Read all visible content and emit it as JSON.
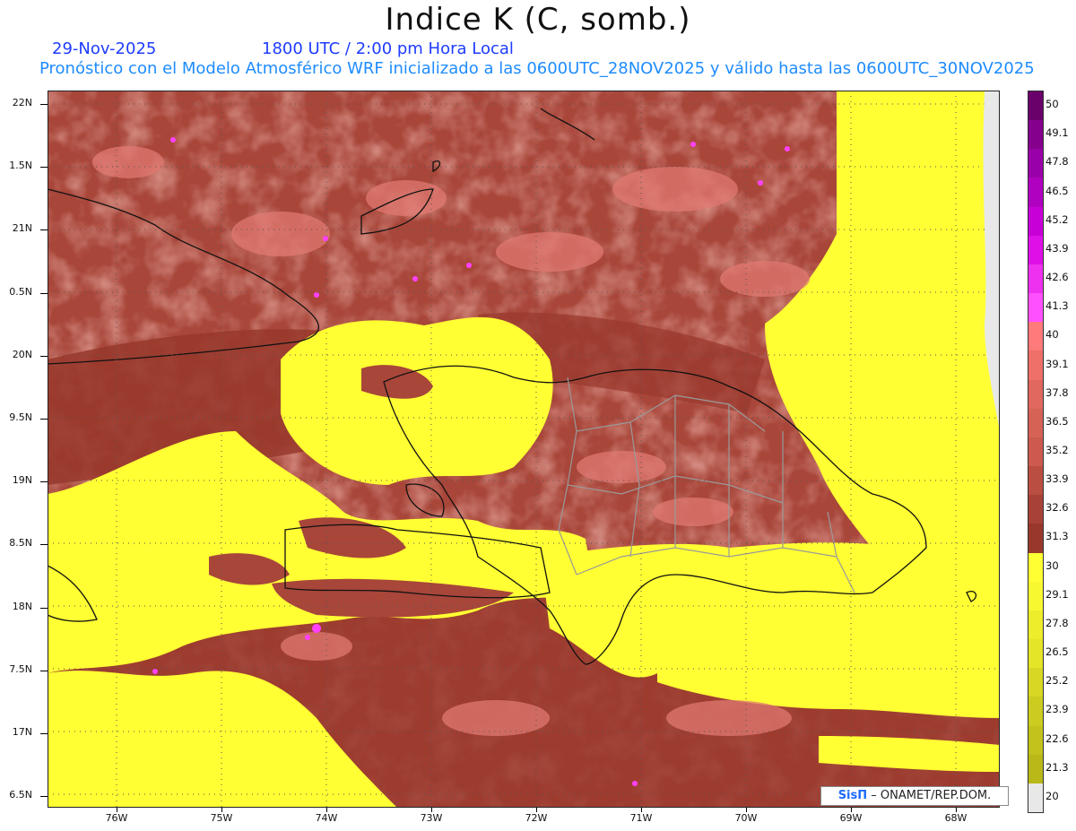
{
  "header": {
    "title": "Indice K (C, somb.)",
    "date": "29-Nov-2025",
    "time": "1800 UTC / 2:00 pm Hora Local",
    "model_line": "Pronóstico con el Modelo Atmosférico WRF inicializado a las 0600UTC_28NOV2025 y válido hasta las  0600UTC_30NOV2025"
  },
  "axes": {
    "lat_labels": [
      "22N",
      "1.5N",
      "21N",
      "0.5N",
      "20N",
      "9.5N",
      "19N",
      "8.5N",
      "18N",
      "7.5N",
      "17N",
      "6.5N"
    ],
    "lon_labels": [
      "76W",
      "75W",
      "74W",
      "73W",
      "72W",
      "71W",
      "70W",
      "69W",
      "68W"
    ]
  },
  "colorbar": {
    "labels": [
      "50",
      "49.1",
      "47.8",
      "46.5",
      "45.2",
      "43.9",
      "42.6",
      "41.3",
      "40",
      "39.1",
      "37.8",
      "36.5",
      "35.2",
      "33.9",
      "32.6",
      "31.3",
      "30",
      "29.1",
      "27.8",
      "26.5",
      "25.2",
      "23.9",
      "22.6",
      "21.3",
      "20"
    ],
    "colors": [
      "#6a006a",
      "#85008c",
      "#9a00a8",
      "#b000c0",
      "#c800d8",
      "#dd10e8",
      "#ee30f0",
      "#ff50ff",
      "#ff7a7a",
      "#ee7068",
      "#e0685e",
      "#d66256",
      "#cc5a4e",
      "#bb4e42",
      "#a84236",
      "#98382c",
      "#ffff33",
      "#f8f830",
      "#eded2c",
      "#e4e428",
      "#d8d824",
      "#cccc20",
      "#c2c21c",
      "#b8b818",
      "#e8e8e8"
    ]
  },
  "credit": {
    "brand": "SisΠ",
    "text": "– ONAMET/REP.DOM."
  },
  "colors": {
    "dark_red": "#98382c",
    "mid_red": "#c0564a",
    "light_red": "#d8706a",
    "yellow": "#ffff33",
    "magenta": "#ff40ff",
    "no_data": "#e8e8e8"
  }
}
